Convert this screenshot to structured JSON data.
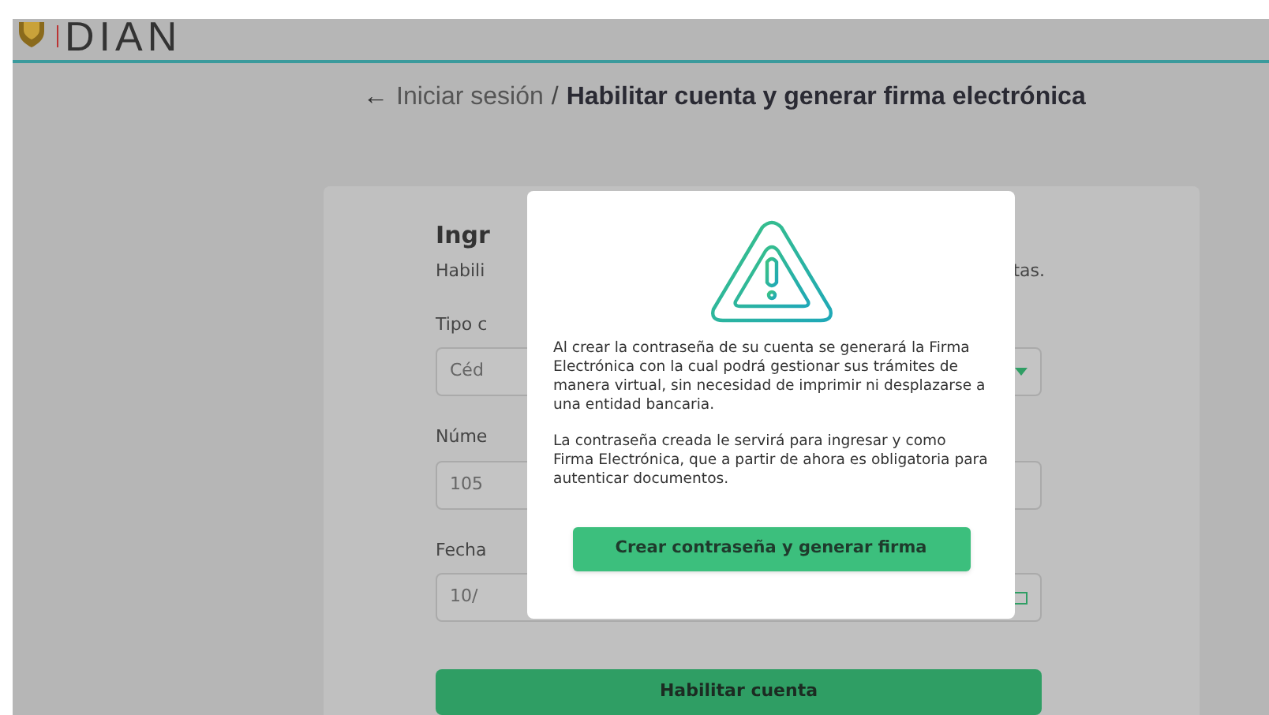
{
  "header": {
    "logo_text": "DIAN"
  },
  "breadcrumb": {
    "back_arrow": "←",
    "link": "Iniciar sesión",
    "separator": "/",
    "current": "Habilitar cuenta y generar firma electrónica"
  },
  "form": {
    "title": "Ingr",
    "subtitle_start": "Habili",
    "subtitle_end": "tas.",
    "fields": [
      {
        "kind": "select",
        "label": "Tipo c",
        "value": "Céd"
      },
      {
        "kind": "text",
        "label": "Núme",
        "value": "105"
      },
      {
        "kind": "date",
        "label": "Fecha",
        "value": "10/"
      }
    ],
    "submit": "Habilitar cuenta"
  },
  "modal": {
    "paragraphs": [
      "Al crear la contraseña de su cuenta se generará la Firma Electrónica con la cual podrá gestionar sus trámites de manera virtual, sin necesidad de imprimir ni desplazarse a una entidad bancaria.",
      "La contraseña creada le servirá para ingresar y como Firma Electrónica, que a partir de ahora es obligatoria para autenticar documentos."
    ],
    "button": "Crear contraseña y generar firma"
  }
}
